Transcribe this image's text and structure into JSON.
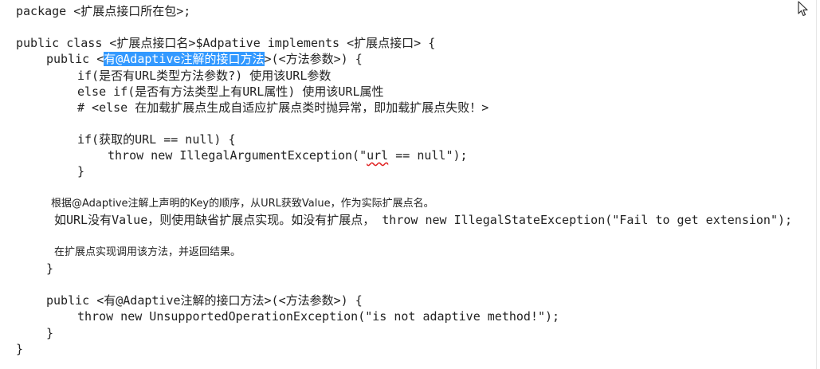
{
  "code": {
    "line1": "package <扩展点接口所在包>;",
    "line2": "public class <扩展点接口名>$Adpative implements <扩展点接口> {",
    "line3_pre": "public <",
    "line3_sel": "有@Adaptive注解的接口方法",
    "line3_post": ">(<方法参数>) {",
    "line4": "if(是否有URL类型方法参数?) 使用该URL参数",
    "line5": "else if(是否有方法类型上有URL属性) 使用该URL属性",
    "line6": "# <else 在加载扩展点生成自适应扩展点类时抛异常，即加载扩展点失败！>",
    "line7": "if(获取的URL == null) {",
    "line8_pre": "throw new IllegalArgumentException(\"",
    "line8_squiggle": "url",
    "line8_post": " == null\");",
    "line9": "}",
    "line10": "根据@Adaptive注解上声明的Key的顺序，从URL获致Value，作为实际扩展点名。",
    "line11": "如URL没有Value，则使用缺省扩展点实现。如没有扩展点， throw new IllegalStateException(\"Fail to get extension\");",
    "line12": "在扩展点实现调用该方法，并返回结果。",
    "line13": "}",
    "line14": "public <有@Adaptive注解的接口方法>(<方法参数>) {",
    "line15": "throw new UnsupportedOperationException(\"is not adaptive method!\");",
    "line16": "}",
    "line17": "}"
  },
  "colors": {
    "selection": "#3399ff",
    "text": "#222222",
    "squiggle": "#e02020"
  },
  "icons": [
    "mouse-cursor-icon"
  ]
}
